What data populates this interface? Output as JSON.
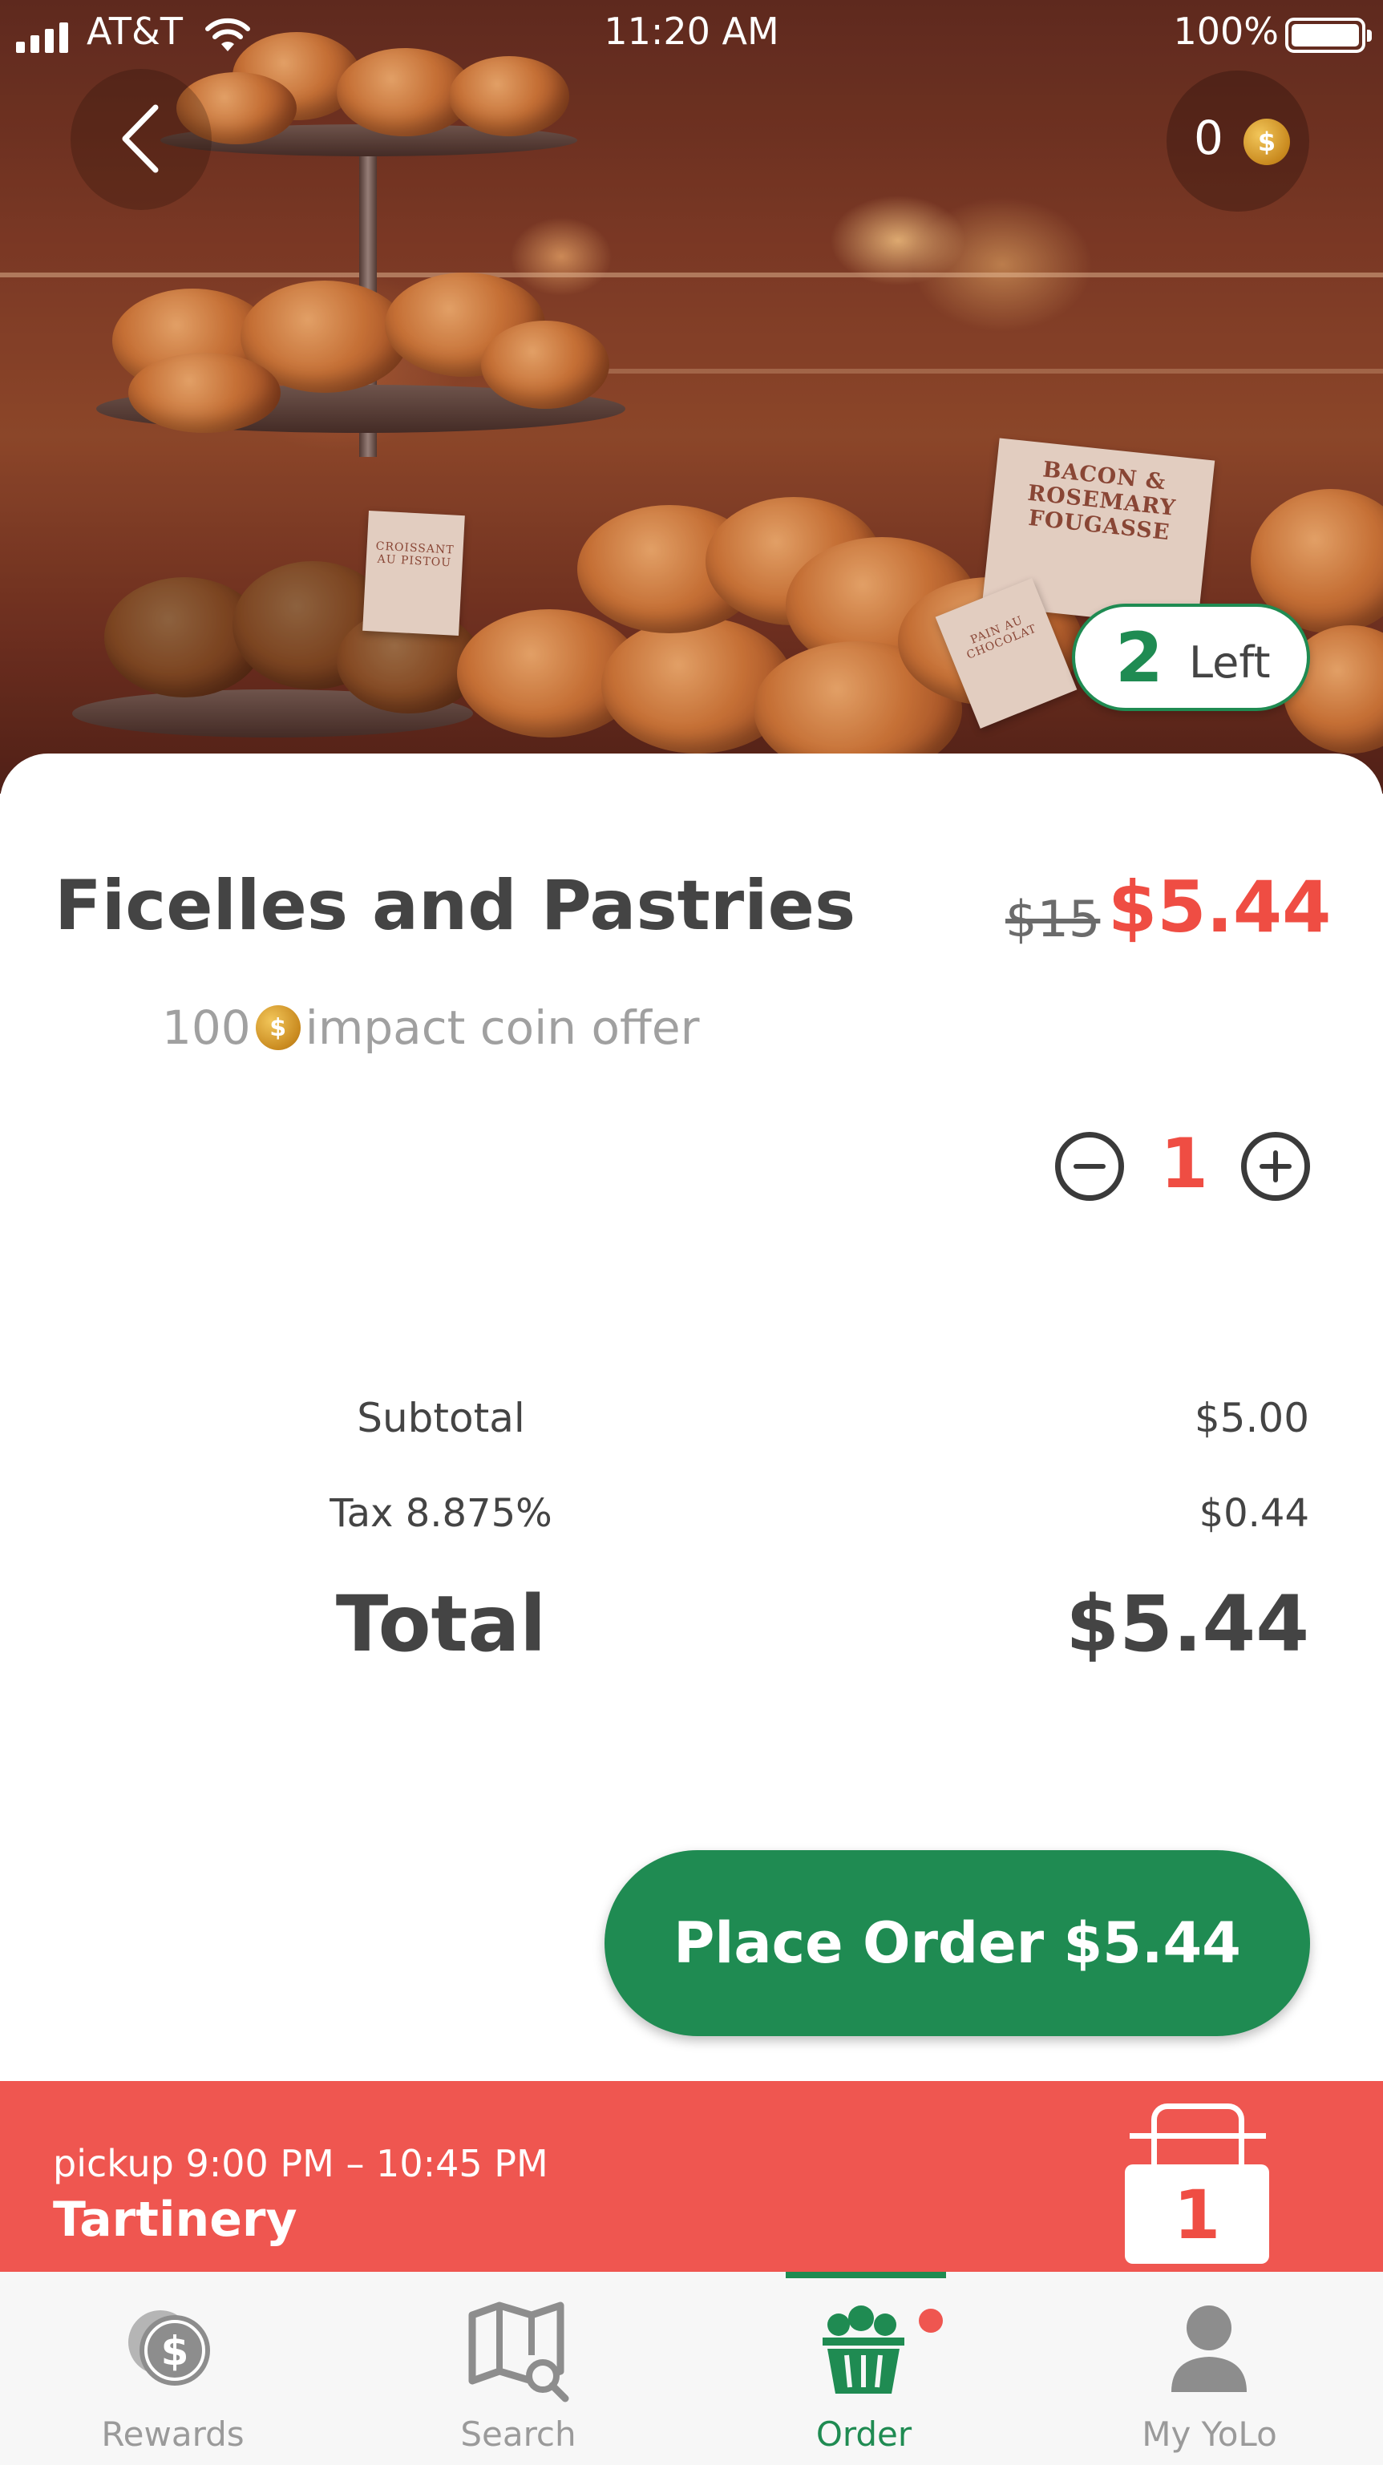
{
  "status_bar": {
    "carrier": "AT&T",
    "time": "11:20 AM",
    "battery": "100%"
  },
  "header": {
    "coin_count": "0",
    "remaining_count": "2",
    "remaining_label": "Left"
  },
  "hero_signs": {
    "sign1": "BACON & ROSEMARY FOUGASSE",
    "sign2": "CROISSANT AU PISTOU",
    "sign3": "PAIN AU CHOCOLAT"
  },
  "product": {
    "title": "Ficelles and Pastries",
    "old_price": "$15",
    "new_price": "$5.44",
    "coin_amount": "100",
    "coin_offer_label": "impact coin offer",
    "quantity": "1"
  },
  "summary": {
    "subtotal_label": "Subtotal",
    "subtotal_value": "$5.00",
    "tax_label": "Tax 8.875%",
    "tax_value": "$0.44",
    "total_label": "Total",
    "total_value": "$5.44"
  },
  "order_button": "Place Order $5.44",
  "pickup": {
    "time": "pickup 9:00 PM – 10:45 PM",
    "store": "Tartinery",
    "bag_count": "1"
  },
  "tabs": [
    {
      "label": "Rewards",
      "icon": "rewards-coin-icon"
    },
    {
      "label": "Search",
      "icon": "map-search-icon"
    },
    {
      "label": "Order",
      "icon": "basket-icon"
    },
    {
      "label": "My YoLo",
      "icon": "person-icon"
    }
  ],
  "colors": {
    "accent_green": "#1f8b52",
    "accent_red": "#ef4d43",
    "pickup_bar": "#ef5650"
  }
}
